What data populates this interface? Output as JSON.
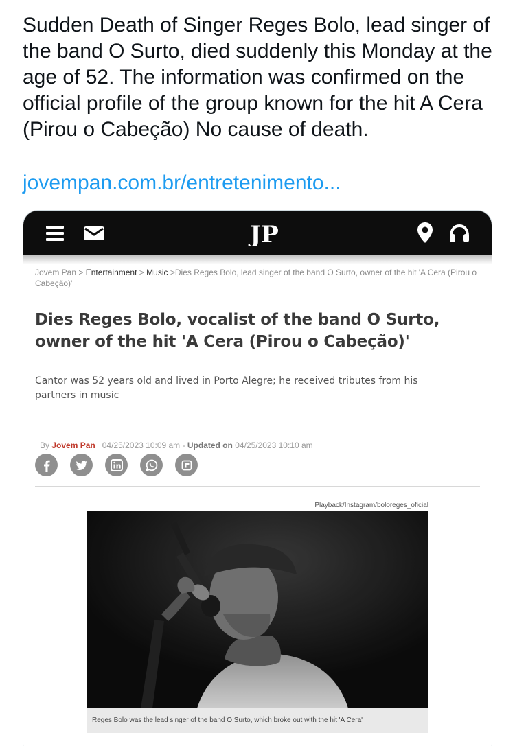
{
  "tweet": {
    "text": "Sudden Death of Singer Reges Bolo, lead singer of the band O Surto, died suddenly this Monday at the age of 52. The information was confirmed on the official profile of the group known for the hit A Cera (Pirou o Cabeção) No cause of death.",
    "link": "jovempan.com.br/entretenimento..."
  },
  "card": {
    "topbar": {
      "logo_text": "JP",
      "icons": [
        "menu-icon",
        "mail-icon",
        "location-pin-icon",
        "headphones-icon"
      ]
    },
    "breadcrumb": {
      "items": [
        "Jovem Pan",
        "Entertainment",
        "Music",
        "Dies Reges Bolo, lead singer of the band O Surto, owner of the hit 'A Cera (Pirou o Cabeção)'"
      ],
      "separator": ">"
    },
    "headline": "Dies Reges Bolo, vocalist of the band O Surto, owner of the hit 'A Cera (Pirou o Cabeção)'",
    "subtitle": "Cantor was 52 years old and lived in Porto Alegre; he received tributes from his partners in music",
    "byline": {
      "by": "By",
      "author": "Jovem Pan",
      "published": "04/25/2023 10:09 am",
      "dash": "-",
      "updated_label": "Updated on",
      "updated": "04/25/2023 10:10 am"
    },
    "share_icons": [
      "facebook-icon",
      "twitter-icon",
      "linkedin-icon",
      "whatsapp-icon",
      "flipboard-icon"
    ],
    "photo": {
      "credit": "Playback/Instagram/boloreges_oficial",
      "caption": "Reges Bolo was the lead singer of the band O Surto, which broke out with the hit 'A Cera'"
    }
  },
  "colors": {
    "link_blue": "#1d9bf0",
    "topbar": "#0d0d0d",
    "author_red": "#c0392b",
    "share_gray": "#8f8f8f"
  }
}
